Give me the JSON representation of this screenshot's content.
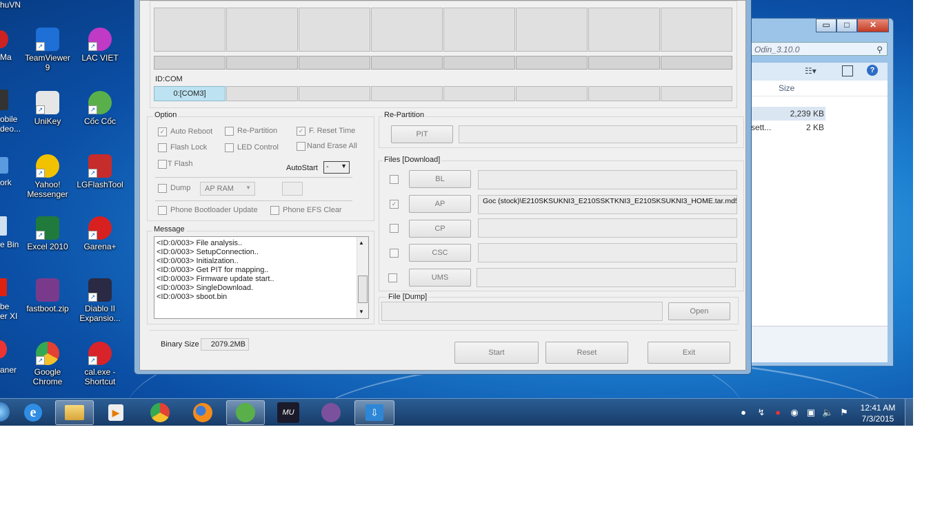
{
  "desktop": {
    "top_left_label": "huVN",
    "cut_labels": [
      "Ma",
      "obile",
      "deo...",
      "ork",
      "e Bin",
      "be",
      "er XI",
      "aner"
    ],
    "icons": [
      {
        "label": "TeamViewer 9",
        "line1": "TeamViewer",
        "line2": "9",
        "icon": "teamviewer-icon",
        "color": "#1e6fd6"
      },
      {
        "label": "LAC VIET",
        "line1": "LAC VIET",
        "line2": "",
        "icon": "lac-viet-icon",
        "color": "#c03ac6"
      },
      {
        "label": "UniKey",
        "line1": "UniKey",
        "line2": "",
        "icon": "unikey-icon",
        "color": "#e6e6e6"
      },
      {
        "label": "Cốc Cốc",
        "line1": "Cốc Cốc",
        "line2": "",
        "icon": "coc-coc-icon",
        "color": "#59b04a"
      },
      {
        "label": "Yahoo! Messenger",
        "line1": "Yahoo!",
        "line2": "Messenger",
        "icon": "yahoo-messenger-icon",
        "color": "#f2c200"
      },
      {
        "label": "LGFlashTool",
        "line1": "LGFlashTool",
        "line2": "",
        "icon": "lg-flash-tool-icon",
        "color": "#c62c2c"
      },
      {
        "label": "Excel 2010",
        "line1": "Excel 2010",
        "line2": "",
        "icon": "excel-icon",
        "color": "#1f7a3c"
      },
      {
        "label": "Garena+",
        "line1": "Garena+",
        "line2": "",
        "icon": "garena-icon",
        "color": "#d82020"
      },
      {
        "label": "fastboot.zip",
        "line1": "fastboot.zip",
        "line2": "",
        "icon": "winrar-archive-icon",
        "color": "#7a3a8c"
      },
      {
        "label": "Diablo II Expansio...",
        "line1": "Diablo II",
        "line2": "Expansio...",
        "icon": "diablo-icon",
        "color": "#2a2a44"
      },
      {
        "label": "Google Chrome",
        "line1": "Google",
        "line2": "Chrome",
        "icon": "chrome-icon",
        "color": "#e34133"
      },
      {
        "label": "cal.exe - Shortcut",
        "line1": "cal.exe -",
        "line2": "Shortcut",
        "icon": "cal-exe-icon",
        "color": "#d8232a"
      }
    ]
  },
  "explorer": {
    "search_placeholder": "Odin_3.10.0",
    "column_size": "Size",
    "files": [
      {
        "name": "",
        "size": "2,239 KB"
      },
      {
        "name": "sett...",
        "size": "2 KB"
      }
    ],
    "buttons": {
      "minimize": "▭",
      "maximize": "□",
      "close": "✕"
    }
  },
  "odin": {
    "id_com_label": "ID:COM",
    "com_port": "0:[COM3]",
    "option": {
      "title": "Option",
      "auto_reboot": "Auto Reboot",
      "re_partition": "Re-Partition",
      "f_reset_time": "F. Reset Time",
      "flash_lock": "Flash Lock",
      "led_control": "LED Control",
      "nand_erase_all": "Nand Erase All",
      "t_flash": "T Flash",
      "autostart_label": "AutoStart",
      "autostart_value": "-",
      "dump": "Dump",
      "dump_target": "AP RAM",
      "phone_bootloader_update": "Phone Bootloader Update",
      "phone_efs_clear": "Phone EFS Clear"
    },
    "message": {
      "title": "Message",
      "lines": [
        "<ID:0/003> File analysis..",
        "<ID:0/003> SetupConnection..",
        "<ID:0/003> Initialzation..",
        "<ID:0/003> Get PIT for mapping..",
        "<ID:0/003> Firmware update start..",
        "<ID:0/003> SingleDownload.",
        "<ID:0/003> sboot.bin"
      ]
    },
    "binary_size_label": "Binary Size",
    "binary_size_value": "2079.2MB",
    "repartition": {
      "title": "Re-Partition",
      "pit_button": "PIT"
    },
    "files_download": {
      "title": "Files [Download]",
      "rows": [
        {
          "button": "BL",
          "path": "",
          "checked": false
        },
        {
          "button": "AP",
          "path": "Goc (stock)\\E210SKSUKNI3_E210SSKTKNI3_E210SKSUKNI3_HOME.tar.md5",
          "checked": true
        },
        {
          "button": "CP",
          "path": "",
          "checked": false
        },
        {
          "button": "CSC",
          "path": "",
          "checked": false
        },
        {
          "button": "UMS",
          "path": "",
          "checked": false
        }
      ]
    },
    "file_dump": {
      "title": "File [Dump]",
      "open_button": "Open"
    },
    "actions": {
      "start": "Start",
      "reset": "Reset",
      "exit": "Exit"
    }
  },
  "taskbar": {
    "apps": [
      {
        "name": "internet-explorer",
        "icon": "internet-explorer-icon"
      },
      {
        "name": "windows-explorer",
        "icon": "folder-icon"
      },
      {
        "name": "media-player",
        "icon": "media-player-icon"
      },
      {
        "name": "chrome",
        "icon": "chrome-icon"
      },
      {
        "name": "firefox",
        "icon": "firefox-icon"
      },
      {
        "name": "coc-coc",
        "icon": "coc-coc-icon"
      },
      {
        "name": "mu-online",
        "icon": "mu-online-icon"
      },
      {
        "name": "viber",
        "icon": "viber-icon"
      },
      {
        "name": "odin",
        "icon": "odin-download-icon"
      }
    ],
    "clock_time": "12:41 AM",
    "clock_date": "7/3/2015"
  }
}
